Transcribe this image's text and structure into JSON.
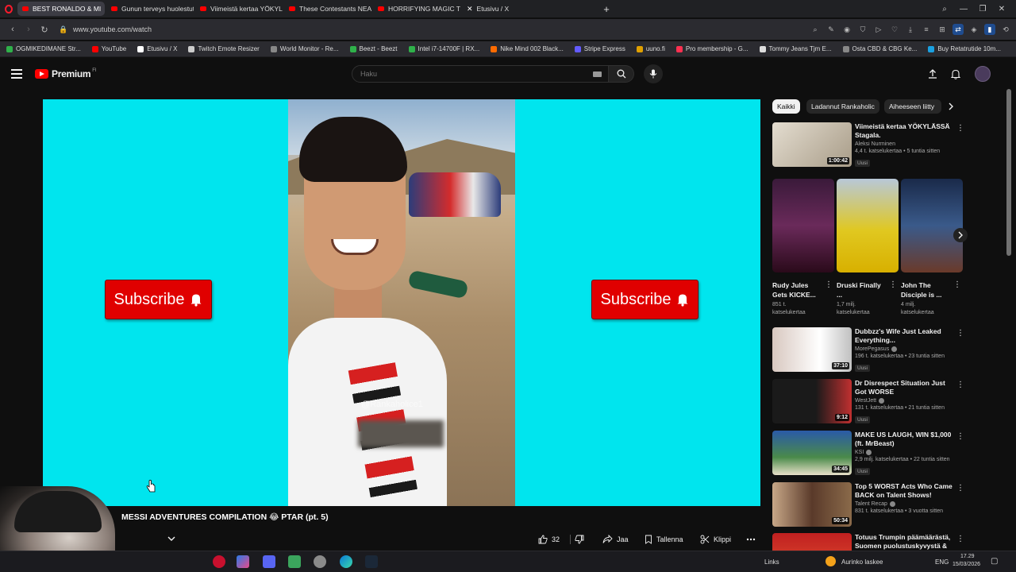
{
  "browser": {
    "tabs": [
      {
        "label": "BEST RONALDO & MI",
        "active": true
      },
      {
        "label": "Gunun terveys huolestutt",
        "active": false
      },
      {
        "label": "Viimeistä kertaa YÖKYLÄS",
        "active": false
      },
      {
        "label": "These Contestants NEARL",
        "active": false
      },
      {
        "label": "HORRIFYING MAGIC That",
        "active": false
      },
      {
        "label": "Etusivu / X",
        "active": false
      }
    ],
    "url": "www.youtube.com/watch",
    "bookmarks": [
      {
        "label": "OGMIKEDIMANE Str...",
        "color": "#2fb14a"
      },
      {
        "label": "YouTube",
        "color": "#ff0000"
      },
      {
        "label": "Etusivu / X",
        "color": "#ffffff"
      },
      {
        "label": "Twitch Emote Resizer",
        "color": "#cccccc"
      },
      {
        "label": "World Monitor - Re...",
        "color": "#888888"
      },
      {
        "label": "Beezt - Beezt",
        "color": "#2fb14a"
      },
      {
        "label": "Intel i7-14700F | RX...",
        "color": "#2fb14a"
      },
      {
        "label": "Nike Mind 002 Black...",
        "color": "#ff6b00"
      },
      {
        "label": "Stripe Express",
        "color": "#635bff"
      },
      {
        "label": "uuno.fi",
        "color": "#e0a000"
      },
      {
        "label": "Pro membership - G...",
        "color": "#ff3050"
      },
      {
        "label": "Tommy Jeans Tjm E...",
        "color": "#dddddd"
      },
      {
        "label": "Osta CBD & CBG Ke...",
        "color": "#888888"
      },
      {
        "label": "Buy Retatrutide 10m...",
        "color": "#1aa0e0"
      }
    ]
  },
  "header": {
    "logo_text": "Premium",
    "logo_superscript": "FI",
    "search_placeholder": "Haku"
  },
  "player": {
    "subscribe_label": "Subscribe",
    "watermark": "@Rankaholice1"
  },
  "video": {
    "title": "MESSI ADVENTURES COMPILATION 😂 PTAR (pt. 5)",
    "likes": "32",
    "share_label": "Jaa",
    "save_label": "Tallenna",
    "clip_label": "Klippi"
  },
  "chips": [
    "Kaikki",
    "Ladannut Rankaholic",
    "Aiheeseen liitty"
  ],
  "recommendations": [
    {
      "title": "Viimeistä kertaa YÖKYLÄSSÄ Stagala.",
      "channel": "Aleksi Nurminen",
      "meta": "4,4 t. katselukertaa • 5 tuntia sitten",
      "badge": "Uusi",
      "duration": "1:00:42",
      "verified": false,
      "thumb_color": "#c9c2b4"
    },
    {
      "title": "Dubbzz's Wife Just Leaked Everything...",
      "channel": "MorePegasus",
      "meta": "196 t. katselukertaa • 23 tuntia sitten",
      "badge": "Uusi",
      "duration": "37:10",
      "verified": true,
      "thumb_color": "#3a2f33"
    },
    {
      "title": "Dr Disrespect Situation Just Got WORSE",
      "channel": "WestJett",
      "meta": "131 t. katselukertaa • 21 tuntia sitten",
      "badge": "Uusi",
      "duration": "9:12",
      "verified": true,
      "thumb_color": "#2b1c1c"
    },
    {
      "title": "MAKE US LAUGH, WIN $1,000 (ft. MrBeast)",
      "channel": "KSI",
      "meta": "2,9 milj. katselukertaa • 22 tuntia sitten",
      "badge": "Uusi",
      "duration": "34:45",
      "verified": true,
      "thumb_color": "#3b6aa8"
    },
    {
      "title": "Top 5 WORST Acts Who Came BACK on Talent Shows!",
      "channel": "Talent Recap",
      "meta": "831 t. katselukertaa • 3 vuotta sitten",
      "badge": "",
      "duration": "50:34",
      "verified": true,
      "thumb_color": "#5a3a2a"
    },
    {
      "title": "Totuus Trumpin päämäärästä, Suomen puolustuskyvystä & ...",
      "channel": "",
      "meta": "",
      "badge": "",
      "duration": "",
      "verified": false,
      "thumb_color": "#8a2a1a"
    }
  ],
  "shorts": [
    {
      "title": "Rudy Jules Gets KICKE...",
      "views": "851 t. katselukertaa",
      "thumb_color": "#5a2a4a"
    },
    {
      "title": "Druski Finally ...",
      "views": "1,7 milj. katselukertaa",
      "thumb_color": "#c8b020"
    },
    {
      "title": "John The Disciple is ...",
      "views": "4 milj. katselukertaa",
      "thumb_color": "#3a4a7a"
    }
  ],
  "taskbar": {
    "links_label": "Links",
    "weather": "Aurinko laskee",
    "language": "ENG",
    "time": "17.29",
    "date": "15/03/2026"
  }
}
